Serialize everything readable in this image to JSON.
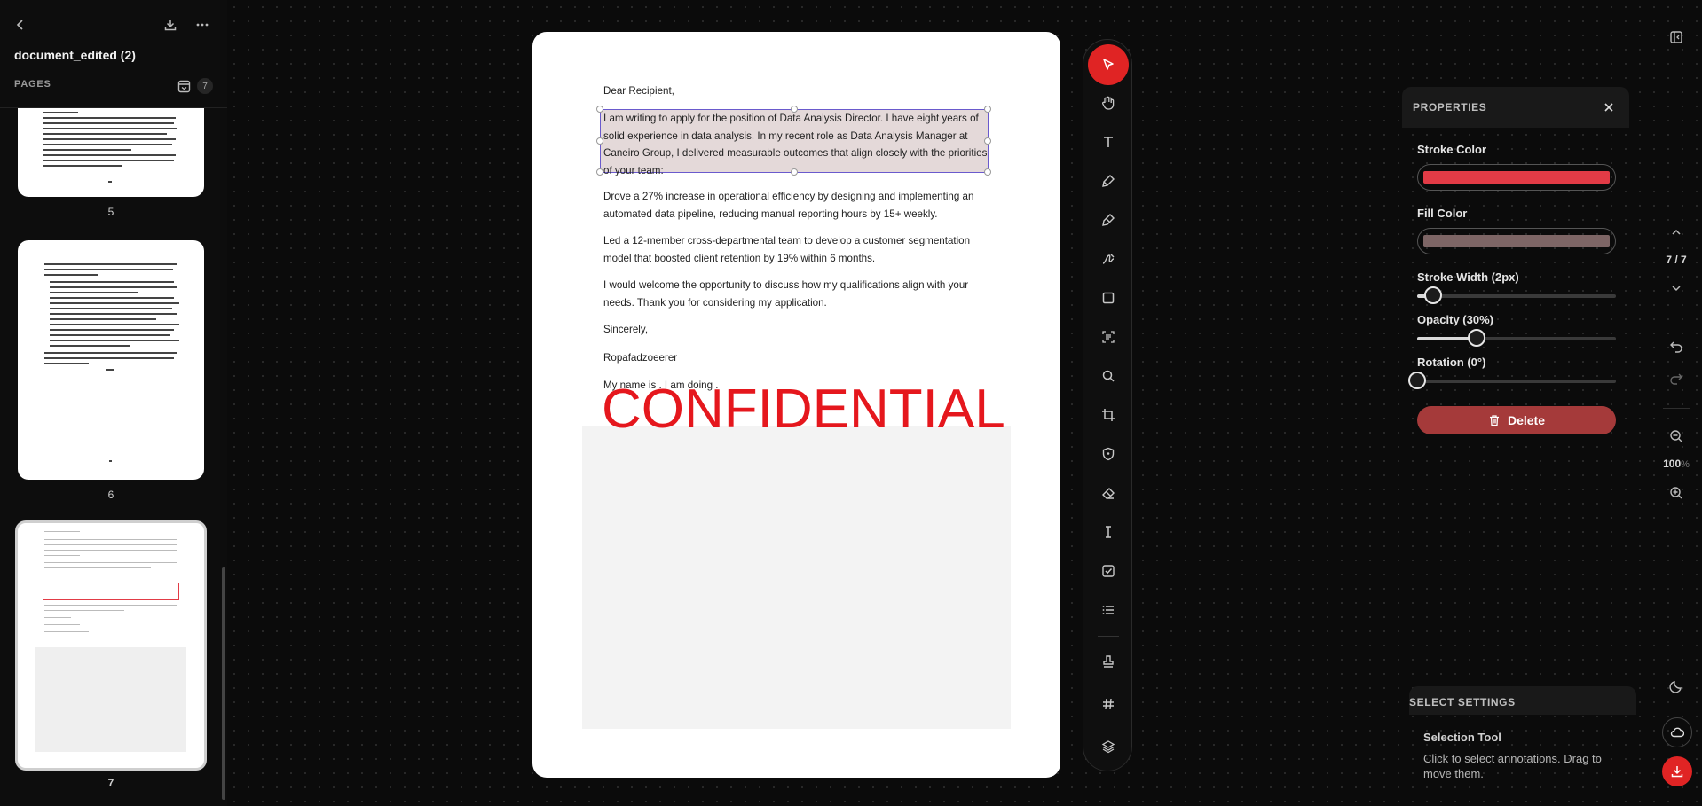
{
  "sidebar": {
    "title": "document_edited (2)",
    "pages_label": "PAGES",
    "page_count": "7",
    "thumbnails": [
      {
        "number": "5"
      },
      {
        "number": "6"
      },
      {
        "number": "7"
      }
    ]
  },
  "document": {
    "greeting": "Dear Recipient,",
    "paragraph1": "I am writing to apply for the position of Data Analysis Director. I have eight years of solid experience in data analysis. In my recent role as Data Analysis Manager at Caneiro Group, I delivered measurable outcomes that align closely with the priorities of your team:",
    "paragraph2": "Drove a 27% increase in operational efficiency by designing and implementing an automated data pipeline, reducing manual reporting hours by 15+ weekly.",
    "paragraph3": "Led a 12-member cross-departmental team to develop a customer segmentation model that boosted client retention by 19% within 6 months.",
    "paragraph4": "I would welcome the opportunity to discuss how my qualifications align with your needs. Thank you for considering my application.",
    "closing": "Sincerely,",
    "signature": "Ropafadzoeerer",
    "note": "My name is . I am doing .",
    "stamp": "CONFIDENTIAL"
  },
  "toolbar": {
    "tools": [
      "select-icon",
      "hand-icon",
      "text-icon",
      "pen-icon",
      "highlighter-icon",
      "signature-icon",
      "rectangle-icon",
      "ocr-scan-icon",
      "search-icon",
      "crop-icon",
      "shield-icon",
      "eraser-icon",
      "text-cursor-icon",
      "checkbox-icon",
      "list-icon",
      "stamp-icon",
      "hash-icon",
      "layers-icon"
    ]
  },
  "properties": {
    "title": "PROPERTIES",
    "stroke_color_label": "Stroke Color",
    "stroke_color": "#e23b46",
    "fill_color_label": "Fill Color",
    "fill_color": "#7d6565",
    "stroke_width_label": "Stroke Width (2px)",
    "stroke_width_value": 0.08,
    "opacity_label": "Opacity (30%)",
    "opacity_value": 0.3,
    "rotation_label": "Rotation (0°)",
    "rotation_value": 0,
    "delete_label": "Delete"
  },
  "select_settings": {
    "title": "SELECT SETTINGS",
    "tool_name": "Selection Tool",
    "description": "Click to select annotations. Drag to move them."
  },
  "rail": {
    "page_indicator": "7 / 7",
    "zoom": "100",
    "zoom_unit": "%"
  },
  "colors": {
    "accent": "#e02424",
    "delete": "#a53a3a"
  }
}
